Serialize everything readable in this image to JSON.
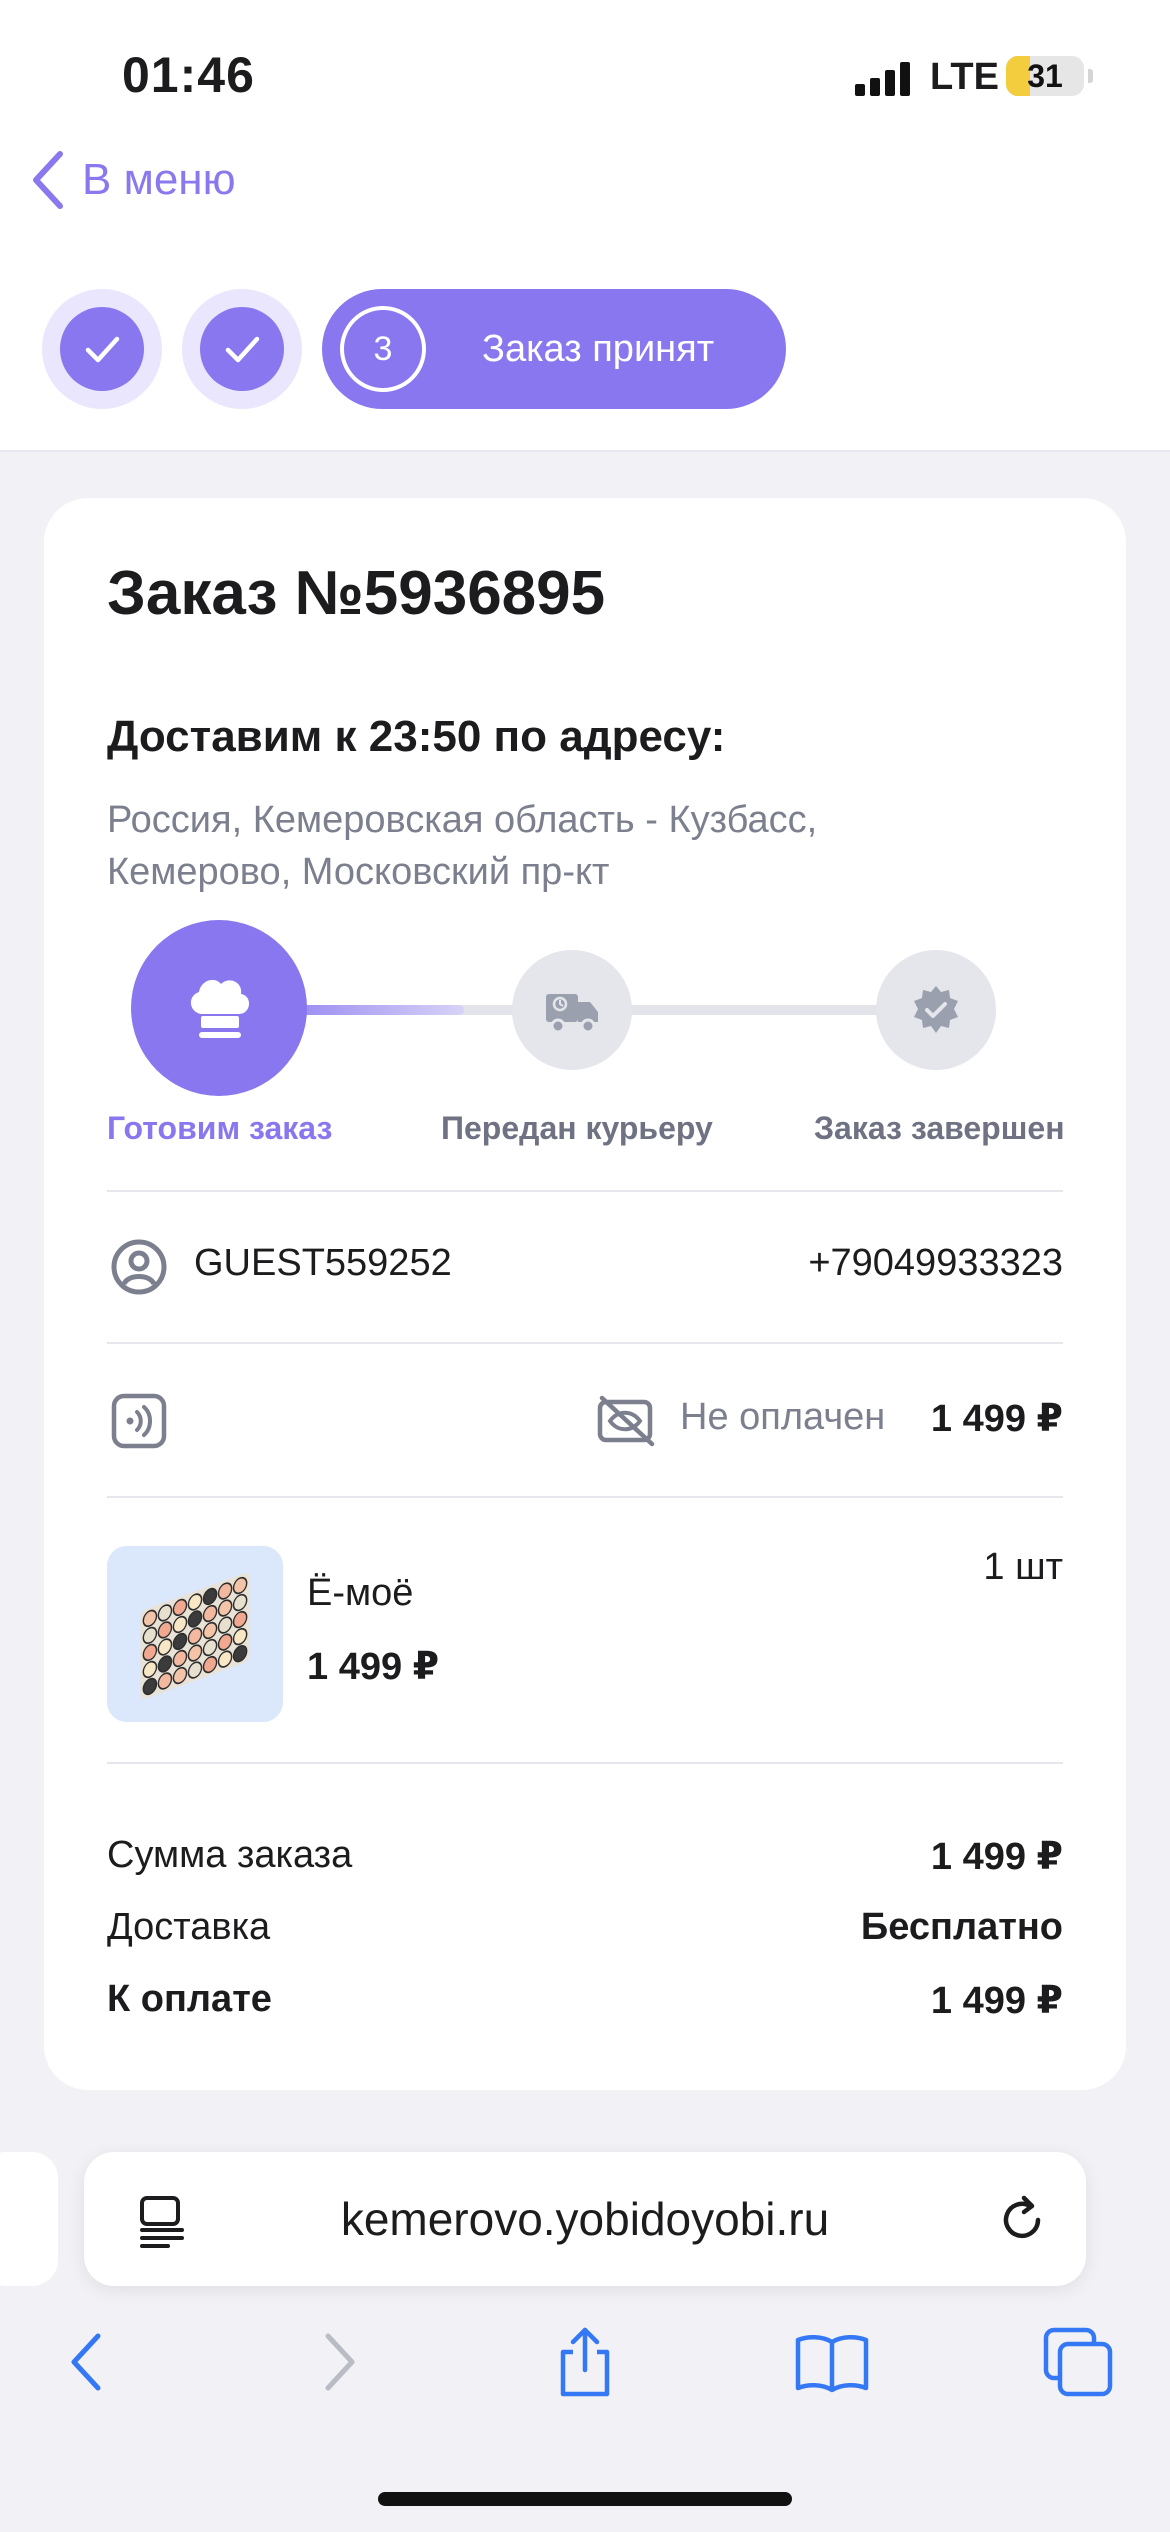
{
  "status_bar": {
    "time": "01:46",
    "network": "LTE",
    "battery_level": "31",
    "battery_fraction": 0.31
  },
  "nav": {
    "back_label": "В меню"
  },
  "steps": {
    "current_number": "3",
    "current_label": "Заказ принят"
  },
  "order": {
    "title": "Заказ №5936895",
    "delivery_title": "Доставим к 23:50 по адресу:",
    "address": "Россия, Кемеровская область - Кузбасс, Кемерово, Московский пр-кт"
  },
  "progress": {
    "stages": [
      "Готовим заказ",
      "Передан курьеру",
      "Заказ завершен"
    ],
    "active_index": 0
  },
  "customer": {
    "name": "GUEST559252",
    "phone": "+79049933323"
  },
  "payment": {
    "status": "Не оплачен",
    "amount": "1 499 ₽"
  },
  "item": {
    "name": "Ё-моё",
    "price": "1 499 ₽",
    "quantity": "1 шт"
  },
  "summary": {
    "subtotal_label": "Сумма заказа",
    "subtotal_value": "1 499 ₽",
    "delivery_label": "Доставка",
    "delivery_value": "Бесплатно",
    "total_label": "К оплате",
    "total_value": "1 499 ₽"
  },
  "browser": {
    "url": "kemerovo.yobidoyobi.ru"
  },
  "colors": {
    "accent": "#8877EF",
    "muted_text": "#7B7F8E",
    "card_bg": "#FFFFFF",
    "page_bg": "#F2F2F6"
  },
  "icons": [
    "chevron-left-icon",
    "check-icon",
    "chef-hat-icon",
    "delivery-truck-icon",
    "badge-check-icon",
    "user-circle-icon",
    "contactless-pay-icon",
    "eye-off-icon",
    "reader-icon",
    "reload-icon",
    "back-arrow-icon",
    "forward-arrow-icon",
    "share-icon",
    "bookmarks-icon",
    "tabs-icon"
  ]
}
